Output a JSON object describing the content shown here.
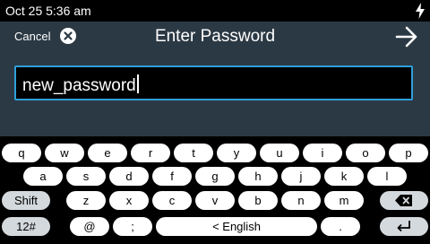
{
  "status": {
    "time": "Oct 25 5:36 am"
  },
  "header": {
    "cancel_label": "Cancel",
    "title": "Enter Password"
  },
  "password": {
    "value": "new_password"
  },
  "keyboard": {
    "row1": [
      "q",
      "w",
      "e",
      "r",
      "t",
      "y",
      "u",
      "i",
      "o",
      "p"
    ],
    "row2": [
      "a",
      "s",
      "d",
      "f",
      "g",
      "h",
      "j",
      "k",
      "l"
    ],
    "row3": [
      "z",
      "x",
      "c",
      "v",
      "b",
      "n",
      "m"
    ],
    "shift_label": "Shift",
    "symbols_label": "12#",
    "at_label": "@",
    "semicolon_label": ";",
    "space_label": "< English",
    "period_label": "."
  },
  "colors": {
    "header_bg": "#2b3944",
    "input_border": "#2f9fda",
    "key_bg": "#ffffff",
    "modifier_key_bg": "#d4d9dd"
  },
  "icons": [
    "bolt-icon",
    "close-circle-icon",
    "arrow-right-icon",
    "backspace-icon",
    "enter-icon"
  ]
}
